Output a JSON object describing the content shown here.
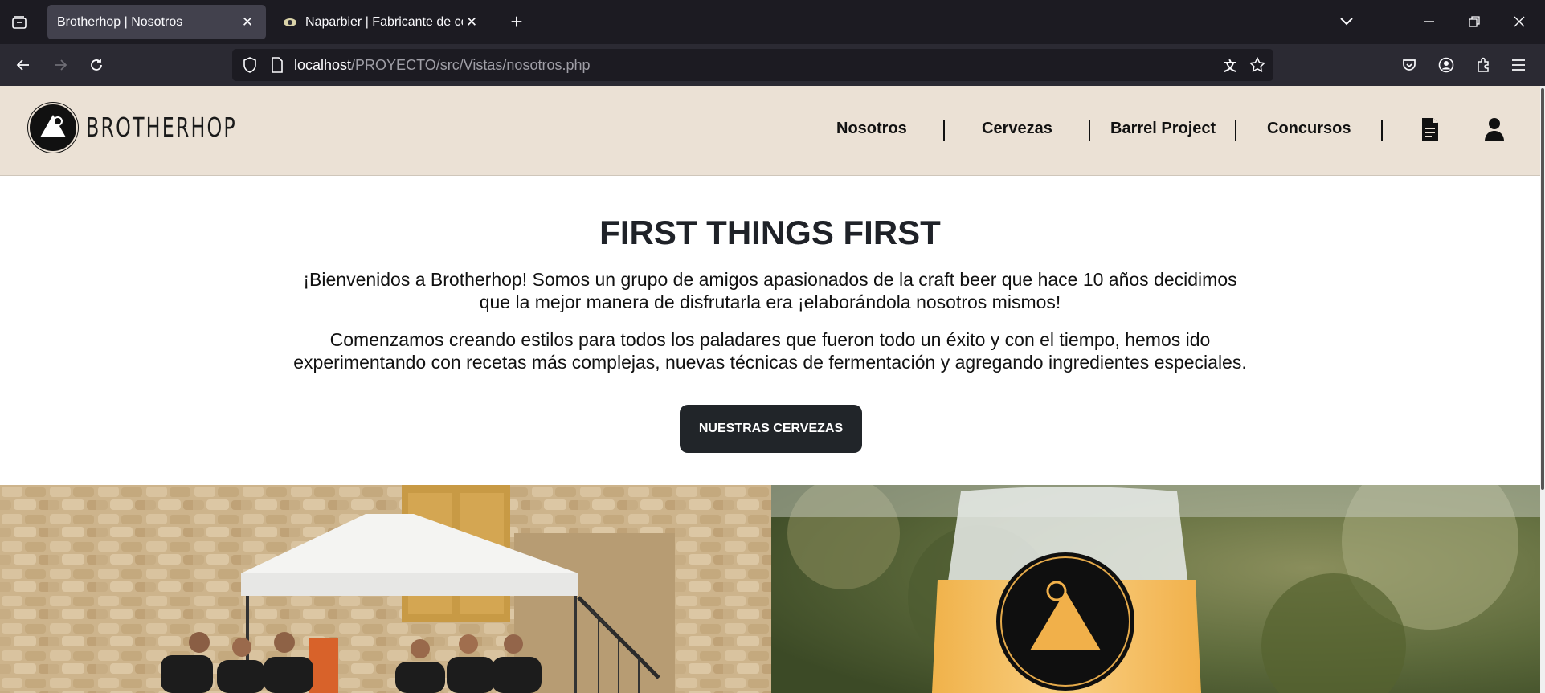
{
  "browser": {
    "tabs": [
      {
        "title": "Brotherhop | Nosotros",
        "active": true
      },
      {
        "title": "Naparbier | Fabricante de cerve",
        "active": false
      }
    ],
    "url": {
      "host": "localhost",
      "path": "/PROYECTO/src/Vistas/nosotros.php"
    }
  },
  "site": {
    "brand": "BROTHERHOP",
    "menu": [
      "Nosotros",
      "Cervezas",
      "Barrel Project",
      "Concursos"
    ],
    "colors": {
      "header_bg": "#ebe1d5",
      "button_bg": "#212529"
    }
  },
  "hero": {
    "title": "FIRST THINGS FIRST",
    "paragraph1_line1": "¡Bienvenidos a Brotherhop! Somos un grupo de amigos apasionados de la craft beer que hace 10 años decidimos",
    "paragraph1_line2": "que la mejor manera de disfrutarla era ¡elaborándola nosotros mismos!",
    "paragraph2_line1": "Comenzamos creando estilos para todos los paladares que fueron todo un éxito y con el tiempo, hemos ido",
    "paragraph2_line2": "experimentando con recetas más complejas, nuevas técnicas de fermentación y agregando ingredientes especiales.",
    "cta": "NUESTRAS CERVEZAS"
  }
}
